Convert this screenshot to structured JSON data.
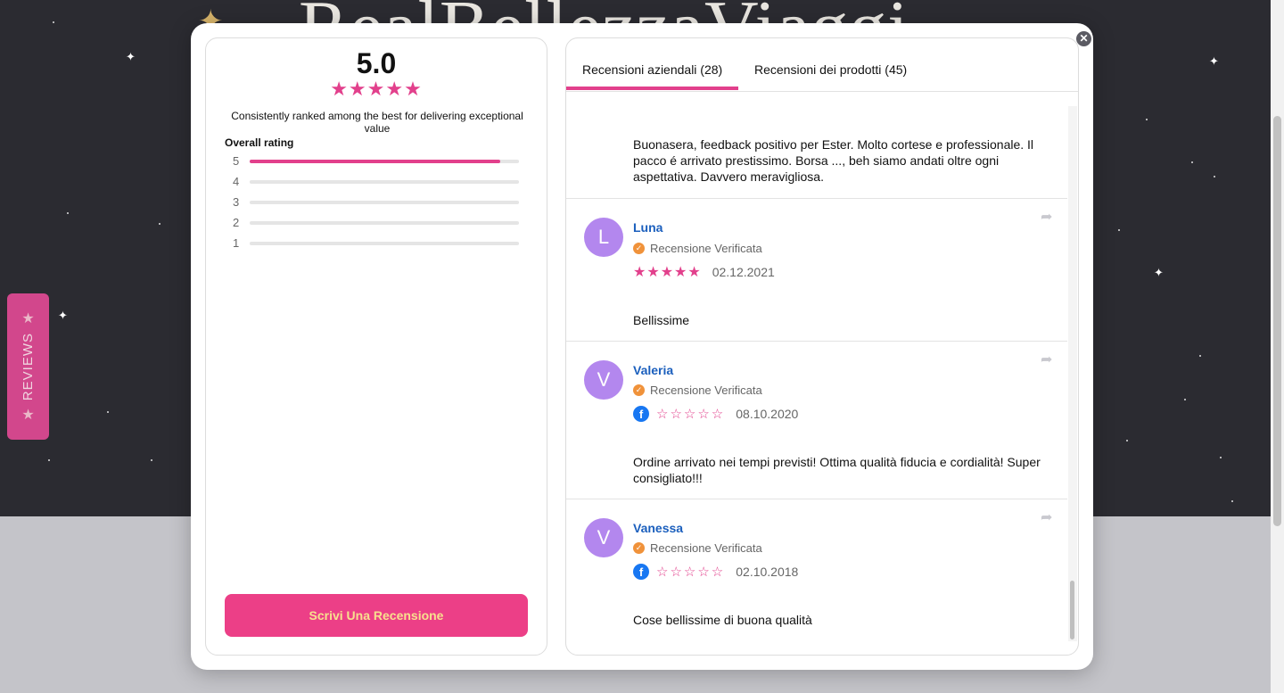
{
  "background": {
    "title": "RealBellezzaViaggi"
  },
  "side_tab": {
    "label": "REVIEWS"
  },
  "summary": {
    "average": "5.0",
    "stars": "★★★★★",
    "description": "Consistently ranked among the best for delivering exceptional value",
    "overall_label": "Overall rating",
    "distribution": [
      {
        "label": "5",
        "fraction": 0.93
      },
      {
        "label": "4",
        "fraction": 0
      },
      {
        "label": "3",
        "fraction": 0
      },
      {
        "label": "2",
        "fraction": 0
      },
      {
        "label": "1",
        "fraction": 0
      }
    ],
    "write_button": "Scrivi Una Recensione"
  },
  "tabs": [
    {
      "label": "Recensioni aziendali (28)",
      "active": true
    },
    {
      "label": "Recensioni dei prodotti (45)",
      "active": false
    }
  ],
  "reviews": [
    {
      "text": "Buonasera, feedback positivo per Ester. Molto cortese e professionale. Il pacco é arrivato prestissimo. Borsa ..., beh siamo andati oltre ogni aspettativa. Davvero meravigliosa."
    },
    {
      "initial": "L",
      "name": "Luna",
      "verified": "Recensione Verificata",
      "stars": "★★★★★",
      "date": "02.12.2021",
      "text": "Bellissime"
    },
    {
      "initial": "V",
      "name": "Valeria",
      "verified": "Recensione Verificata",
      "stars": "☆☆☆☆☆",
      "date": "08.10.2020",
      "text": "Ordine arrivato nei tempi previsti! Ottima qualità fiducia e cordialità! Super consigliato!!!"
    },
    {
      "initial": "V",
      "name": "Vanessa",
      "verified": "Recensione Verificata",
      "stars": "☆☆☆☆☆",
      "date": "02.10.2018",
      "text": "Cose bellissime di buona qualità"
    }
  ],
  "icons": {
    "close": "close-icon",
    "share": "share-icon",
    "verified": "check-badge-icon",
    "facebook": "facebook-icon"
  },
  "colors": {
    "accent": "#e2408c",
    "button": "#ec3f87",
    "avatar": "#b387ee",
    "name": "#1b5fbd"
  }
}
